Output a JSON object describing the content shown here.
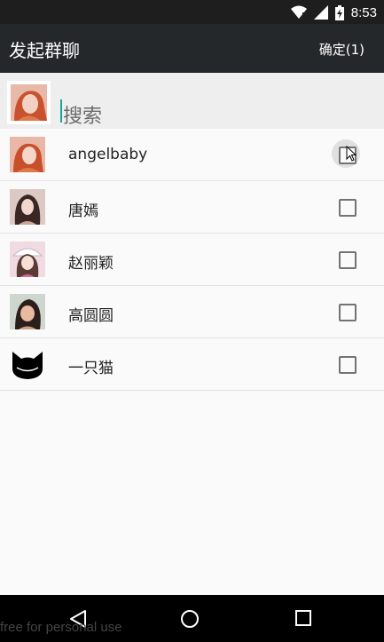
{
  "status_bar": {
    "time": "8:53"
  },
  "app_bar": {
    "title": "发起群聊",
    "confirm_label": "确定(1)"
  },
  "search": {
    "text": "搜索"
  },
  "contacts": [
    {
      "name": "angelbaby",
      "selected": true
    },
    {
      "name": "唐嫣",
      "selected": false
    },
    {
      "name": "赵丽颖",
      "selected": false
    },
    {
      "name": "高圆圆",
      "selected": false
    },
    {
      "name": "一只猫",
      "selected": false
    }
  ],
  "watermark": "free for personal use",
  "colors": {
    "app_bar": "#25282b",
    "status_bar": "#1e1e1e",
    "caret": "#1aa39a"
  }
}
